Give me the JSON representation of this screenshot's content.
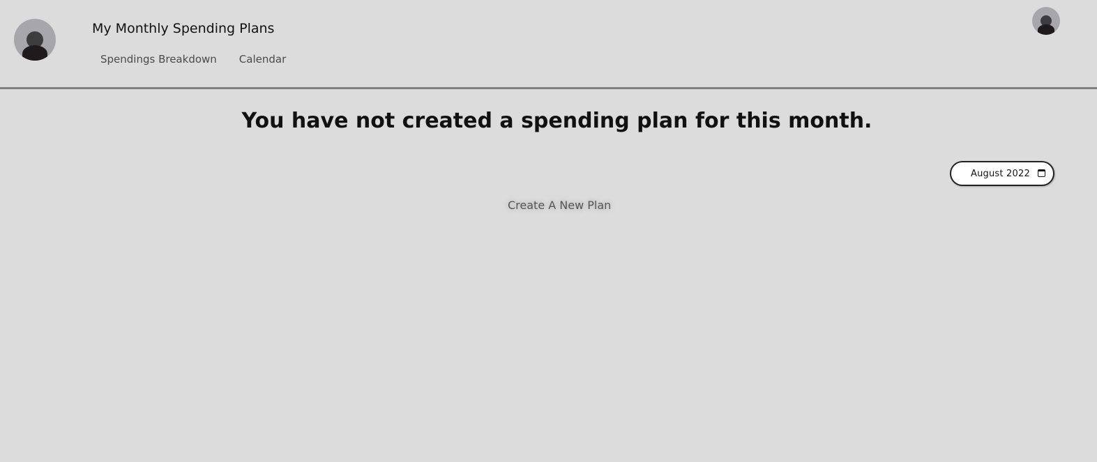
{
  "header": {
    "title": "My Monthly Spending Plans",
    "nav": [
      {
        "label": "Spendings Breakdown"
      },
      {
        "label": "Calendar"
      }
    ]
  },
  "main": {
    "headline": "You have not created a spending plan for this month.",
    "month_picker": {
      "value": "August  2022",
      "icon": "calendar-icon"
    },
    "create_button_label": "Create A New Plan"
  },
  "icons": {
    "logo": "user-avatar-icon",
    "profile": "user-avatar-icon"
  },
  "colors": {
    "background": "#dcdcdc",
    "header_border": "#808080",
    "avatar_bg": "#a7a7ab",
    "text_primary": "#111111",
    "text_muted": "#4a4a4a"
  }
}
